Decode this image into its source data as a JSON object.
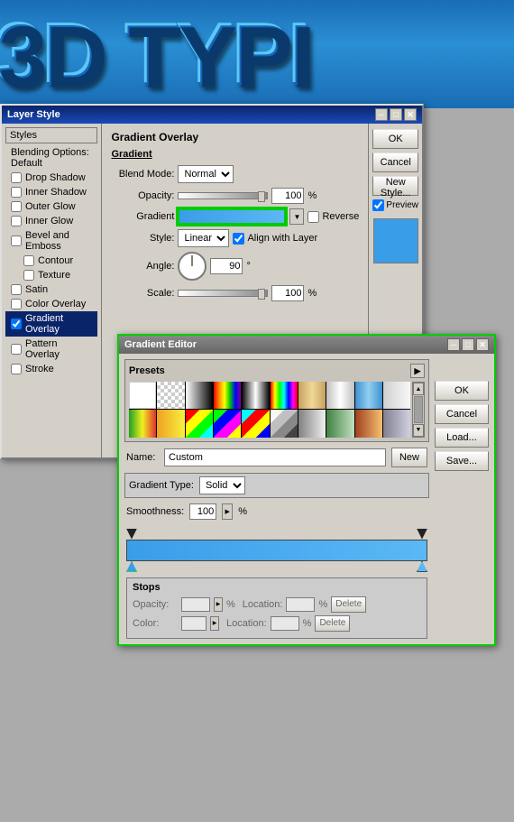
{
  "header": {
    "text": "3D TYPI"
  },
  "layer_style_dialog": {
    "title": "Layer Style",
    "left_panel": {
      "styles_label": "Styles",
      "items": [
        {
          "label": "Blending Options: Default",
          "checked": false,
          "active": false
        },
        {
          "label": "Drop Shadow",
          "checked": false,
          "active": false
        },
        {
          "label": "Inner Shadow",
          "checked": false,
          "active": false
        },
        {
          "label": "Outer Glow",
          "checked": false,
          "active": false
        },
        {
          "label": "Inner Glow",
          "checked": false,
          "active": false
        },
        {
          "label": "Bevel and Emboss",
          "checked": false,
          "active": false
        },
        {
          "label": "Contour",
          "checked": false,
          "active": false
        },
        {
          "label": "Texture",
          "checked": false,
          "active": false
        },
        {
          "label": "Satin",
          "checked": false,
          "active": false
        },
        {
          "label": "Color Overlay",
          "checked": false,
          "active": false
        },
        {
          "label": "Gradient Overlay",
          "checked": true,
          "active": true
        },
        {
          "label": "Pattern Overlay",
          "checked": false,
          "active": false
        },
        {
          "label": "Stroke",
          "checked": false,
          "active": false
        }
      ]
    },
    "section_title": "Gradient Overlay",
    "gradient_label": "Gradient",
    "blend_mode_label": "Blend Mode:",
    "blend_mode_value": "Normal",
    "opacity_label": "Opacity:",
    "opacity_value": "100",
    "opacity_unit": "%",
    "gradient_field_label": "Gradient",
    "reverse_label": "Reverse",
    "style_label": "Style:",
    "style_value": "Linear",
    "align_label": "Align with Layer",
    "angle_label": "Angle:",
    "angle_value": "90",
    "angle_unit": "°",
    "scale_label": "Scale:",
    "scale_value": "100",
    "scale_unit": "%",
    "buttons": {
      "ok": "OK",
      "cancel": "Cancel",
      "new_style": "New Style...",
      "preview": "Preview"
    }
  },
  "gradient_editor": {
    "title": "Gradient Editor",
    "presets_label": "Presets",
    "name_label": "Name:",
    "name_value": "Custom",
    "new_btn": "New",
    "ok_btn": "OK",
    "cancel_btn": "Cancel",
    "load_btn": "Load...",
    "save_btn": "Save...",
    "gradient_type_label": "Gradient Type:",
    "gradient_type_value": "Solid",
    "smoothness_label": "Smoothness:",
    "smoothness_value": "100",
    "smoothness_unit": "%",
    "stops_label": "Stops",
    "opacity_label": "Opacity:",
    "opacity_placeholder": "",
    "opacity_unit": "%",
    "location_label": "Location:",
    "location_unit": "%",
    "delete_btn": "Delete",
    "color_label": "Color:",
    "color_location_label": "Location:",
    "color_delete_btn": "Delete"
  },
  "swatches": {
    "row1": [
      "#ffffff",
      "#cccccc",
      "#d4a0a0",
      "#c8c8c8",
      "#a0a0a0",
      "#606060",
      "#303030",
      "#000000",
      "#b8b030",
      "#404040"
    ],
    "row2": [
      "#808080",
      "#c0c0c0",
      "#e8c890",
      "#d4a060",
      "#a07040",
      "#603820",
      "#c8a878",
      "#e0d0b0",
      "#f0e8c8",
      "#e8e0c0"
    ],
    "row3": [
      "#20a020",
      "#f0c030",
      "#e83030",
      "#2060d0",
      "#c030c0",
      "#30c0c0",
      "#f0f030",
      "#a0c030",
      "#30c060",
      "#3090e0"
    ],
    "row4": [
      "#30c040",
      "#b0e830",
      "#f8f040",
      "#f0a020",
      "#f06020",
      "#e03030",
      "#c82828",
      "#a020a0",
      "#6030c0",
      "#2050c0"
    ],
    "row5": [
      "#c0c0c0",
      "#404040",
      "#c0d8e0",
      "#80a0b0",
      "#607890",
      "#e0e8f0",
      "#b8d0e0",
      "#90a8c0",
      "#a0b8d0",
      "#d0e0e8"
    ],
    "row6": [
      "#c03030",
      "#d06040",
      "#e09060",
      "#f0c080",
      "#f0d890",
      "#e8e0b0",
      "#a0b870",
      "#608040",
      "#305820",
      "#204018"
    ]
  }
}
